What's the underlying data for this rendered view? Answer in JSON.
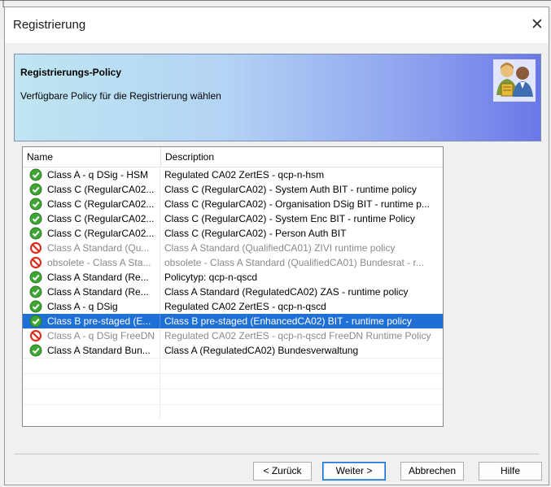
{
  "corner_mark": "[",
  "window": {
    "title": "Registrierung",
    "close_glyph": "✕"
  },
  "banner": {
    "title": "Registrierungs-Policy",
    "subtitle": "Verfügbare Policy für die Registrierung wählen",
    "icon": "users-certificate-icon"
  },
  "list": {
    "columns": [
      "Name",
      "Description"
    ],
    "rows": [
      {
        "name": "Class A - q DSig - HSM",
        "description": "Regulated CA02 ZertES - qcp-n-hsm",
        "status": "ok"
      },
      {
        "name": "Class C (RegularCA02...",
        "description": "Class C (RegularCA02) - System Auth BIT - runtime policy",
        "status": "ok"
      },
      {
        "name": "Class C (RegularCA02...",
        "description": "Class C (RegularCA02) - Organisation DSig BIT - runtime p...",
        "status": "ok"
      },
      {
        "name": "Class C (RegularCA02...",
        "description": "Class C (RegularCA02) - System Enc BIT - runtime Policy",
        "status": "ok"
      },
      {
        "name": "Class C (RegularCA02...",
        "description": "Class C (RegularCA02)  - Person Auth BIT",
        "status": "ok"
      },
      {
        "name": "Class A Standard (Qu...",
        "description": "Class A Standard (QualifiedCA01) ZIVI runtime policy",
        "status": "blocked"
      },
      {
        "name": "obsolete - Class A Sta...",
        "description": "obsolete - Class A Standard (QualifiedCA01) Bundesrat - r...",
        "status": "blocked"
      },
      {
        "name": "Class A Standard (Re...",
        "description": "Policytyp: qcp-n-qscd",
        "status": "ok"
      },
      {
        "name": "Class A Standard (Re...",
        "description": "Class A Standard (RegulatedCA02) ZAS - runtime policy",
        "status": "ok"
      },
      {
        "name": "Class A - q DSig",
        "description": "Regulated CA02 ZertES - qcp-n-qscd",
        "status": "ok"
      },
      {
        "name": "Class B pre-staged (E...",
        "description": "Class B pre-staged (EnhancedCA02) BIT - runtime policy",
        "status": "ok",
        "selected": true
      },
      {
        "name": "Class A - q DSig FreeDN",
        "description": "Regulated CA02 ZertES - qcp-n-qscd FreeDN  Runtime Policy",
        "status": "blocked"
      },
      {
        "name": "Class A Standard Bun...",
        "description": "Class A (RegulatedCA02) Bundesverwaltung",
        "status": "ok"
      }
    ]
  },
  "buttons": {
    "back": "< Zurück",
    "next": "Weiter >",
    "cancel": "Abbrechen",
    "help": "Hilfe"
  },
  "colors": {
    "selection": "#1e6fd6",
    "ok_icon": "#3fa535",
    "blocked_icon": "#d9301f"
  }
}
